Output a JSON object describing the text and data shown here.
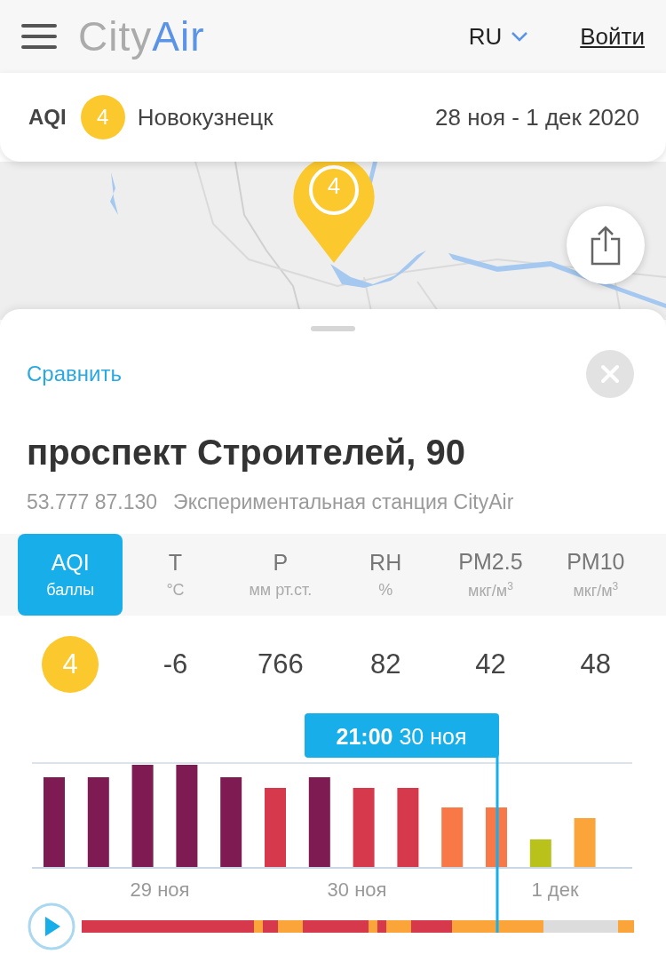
{
  "header": {
    "logo": [
      "City",
      "Air"
    ],
    "language": "RU",
    "login": "Войти"
  },
  "summary": {
    "label": "AQI",
    "aqi": "4",
    "city": "Новокузнецк",
    "period": "28 ноя - 1 дек 2020"
  },
  "map": {
    "pin": "4"
  },
  "panel": {
    "compare": "Сравнить",
    "title": "проспект Строителей, 90",
    "coordinates": "53.777 87.130",
    "station": "Экспериментальная станция CityAir"
  },
  "tabs": [
    {
      "label": "AQI",
      "unit": "баллы",
      "selected": true
    },
    {
      "label": "T",
      "unit": "°C",
      "selected": false
    },
    {
      "label": "P",
      "unit": "мм рт.ст.",
      "selected": false
    },
    {
      "label": "RH",
      "unit": "%",
      "selected": false
    },
    {
      "label": "PM2.5",
      "unit": "мкг/м$^{3}$",
      "selected": false
    },
    {
      "label": "PM10",
      "unit": "мкг/м$^{3}$",
      "selected": false
    }
  ],
  "values": [
    {
      "value": "4",
      "kind": "badge"
    },
    {
      "value": "-6",
      "kind": "plain"
    },
    {
      "value": "766",
      "kind": "plain"
    },
    {
      "value": "82",
      "kind": "plain"
    },
    {
      "value": "42",
      "kind": "plain"
    },
    {
      "value": "48",
      "kind": "plain"
    }
  ],
  "chart": {
    "tooltip_time": "21:00",
    "tooltip_date": "30 ноя",
    "x_labels": [
      "29 ноя",
      "30 ноя",
      "1 дек"
    ]
  }
}
